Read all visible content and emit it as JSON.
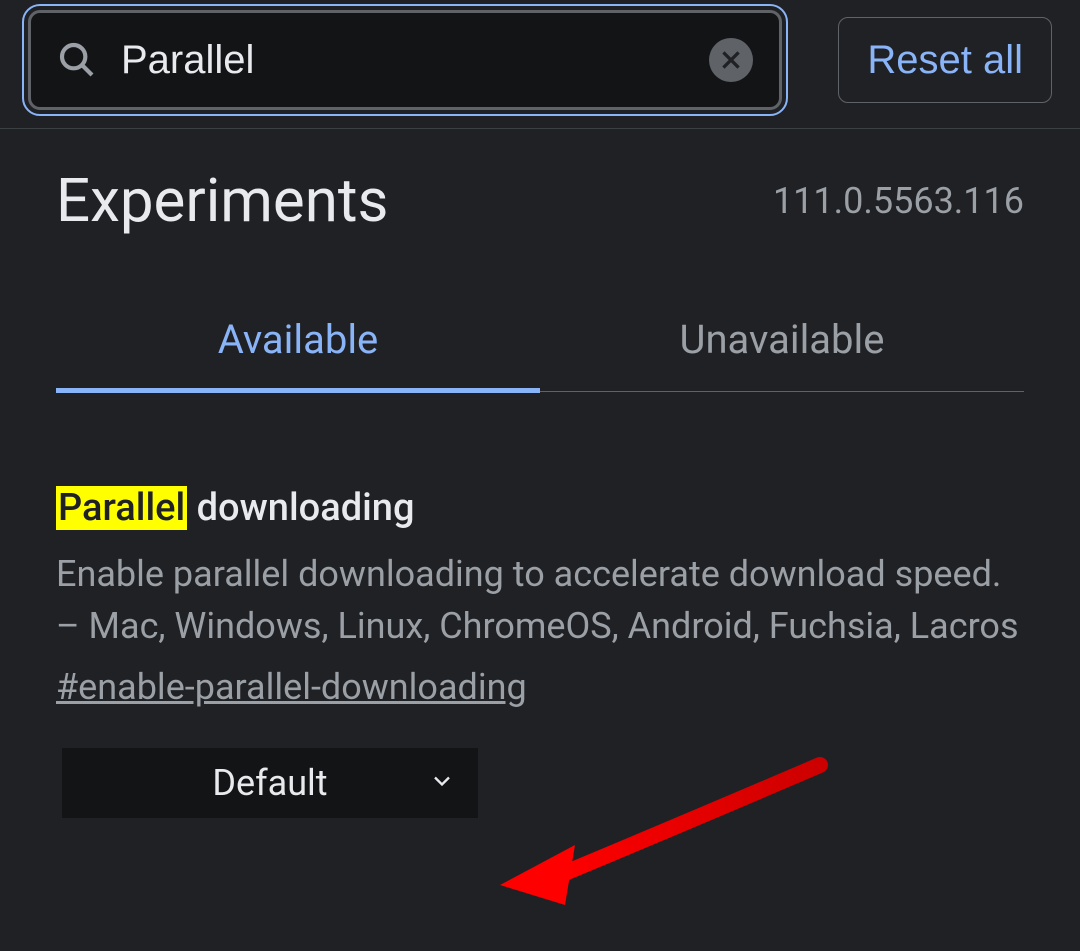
{
  "search": {
    "value": "Parallel"
  },
  "reset_button_label": "Reset all",
  "page_title": "Experiments",
  "version": "111.0.5563.116",
  "tabs": {
    "available": "Available",
    "unavailable": "Unavailable"
  },
  "flag": {
    "title_highlight": "Parallel",
    "title_rest": " downloading",
    "description": "Enable parallel downloading to accelerate download speed. – Mac, Windows, Linux, ChromeOS, Android, Fuchsia, Lacros",
    "hash": "#enable-parallel-downloading",
    "selected_option": "Default"
  }
}
